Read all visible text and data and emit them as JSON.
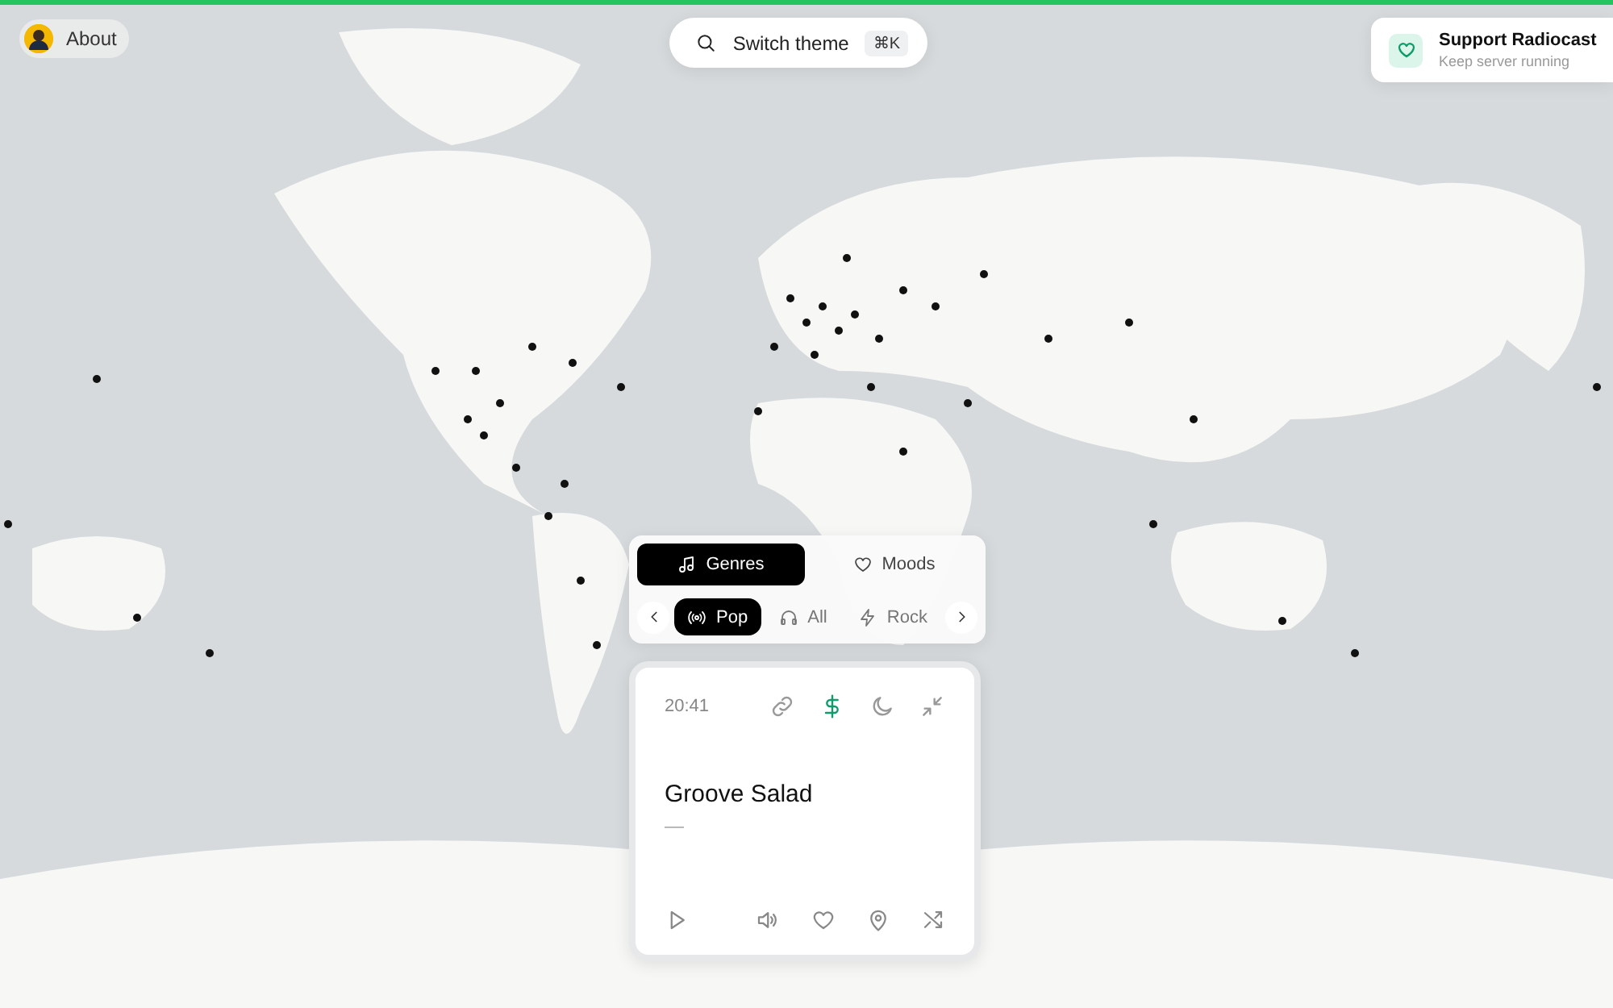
{
  "about": {
    "label": "About"
  },
  "search": {
    "label": "Switch theme",
    "shortcut": "⌘K"
  },
  "support": {
    "title": "Support Radiocast",
    "subtitle": "Keep server running"
  },
  "modes": [
    {
      "label": "Genres",
      "selected": true
    },
    {
      "label": "Moods",
      "selected": false
    }
  ],
  "genres": [
    {
      "label": "Pop",
      "selected": true
    },
    {
      "label": "All",
      "selected": false
    },
    {
      "label": "Rock",
      "selected": false
    }
  ],
  "player": {
    "time": "20:41",
    "title": "Groove Salad",
    "artist": "—",
    "top_actions": [
      {
        "active": false
      },
      {
        "active": true
      },
      {
        "active": false
      },
      {
        "active": false
      }
    ]
  }
}
